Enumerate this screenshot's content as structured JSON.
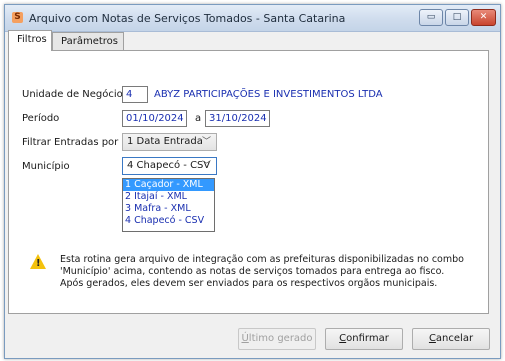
{
  "window": {
    "title": "Arquivo com Notas de Serviços Tomados - Santa Catarina",
    "app_icon": "S",
    "controls": {
      "minimize": "▭",
      "maximize": "□",
      "close": "✕"
    }
  },
  "tabs": [
    {
      "label": "Filtros",
      "active": true
    },
    {
      "label": "Parâmetros",
      "active": false
    }
  ],
  "form": {
    "unidade_label": "Unidade de Negócio",
    "unidade_code": "4",
    "unidade_name": "ABYZ PARTICIPAÇÕES E INVESTIMENTOS LTDA",
    "periodo_label": "Período",
    "periodo_start": "01/10/2024",
    "periodo_sep": "a",
    "periodo_end": "31/10/2024",
    "filtrar_label": "Filtrar Entradas por",
    "filtrar_value": "1 Data Entrada",
    "municipio_label": "Município",
    "municipio_value": "4 Chapecó - CSV",
    "municipio_options": [
      "1 Caçador - XML",
      "2 Itajaí - XML",
      "3 Mafra - XML",
      "4 Chapecó - CSV"
    ],
    "municipio_highlighted_index": 0
  },
  "info": {
    "icon": "warning-icon",
    "message": "Esta rotina gera arquivo de integração com as prefeituras disponibilizadas no combo 'Município' acima, contendo as notas de serviços tomados para entrega ao fisco. Após gerados, eles devem ser enviados para os respectivos orgãos municipais."
  },
  "buttons": {
    "ultimo_first": "Ú",
    "ultimo_rest": "ltimo gerado",
    "confirmar_first": "C",
    "confirmar_rest": "onfirmar",
    "cancelar_first": "C",
    "cancelar_rest": "ancelar"
  },
  "colors": {
    "accent": "#3399ff",
    "value_text": "#1a2fb0",
    "warning": "#f4c20d"
  }
}
